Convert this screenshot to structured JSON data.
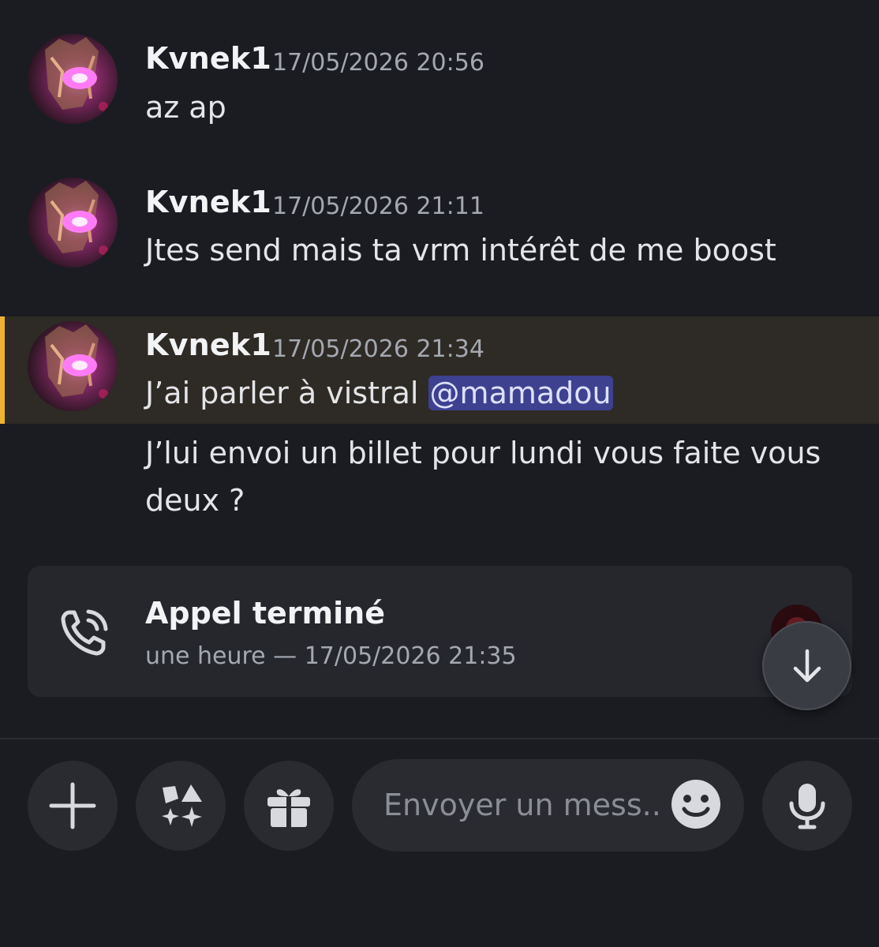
{
  "messages": [
    {
      "author": "Kvnek1",
      "time": "17/05/2026 20:56",
      "lines": [
        "az ap"
      ]
    },
    {
      "author": "Kvnek1",
      "time": "17/05/2026 21:11",
      "lines": [
        "Jtes send mais ta vrm intérêt de me boost"
      ]
    },
    {
      "author": "Kvnek1",
      "time": "17/05/2026 21:34",
      "text_before_mention": "J’ai parler à vistral ",
      "mention": "@mamadou",
      "highlighted": true,
      "accent_color": "#f0b232"
    }
  ],
  "followup_lines": [
    "J’lui envoi un billet pour lundi vous faite vous",
    "deux ?"
  ],
  "call": {
    "title": "Appel terminé",
    "subtitle": "une heure — 17/05/2026 21:35",
    "icon": "phone-call-icon"
  },
  "composer": {
    "placeholder": "Envoyer un mess..",
    "buttons": [
      "plus-icon",
      "apps-icon",
      "gift-icon",
      "microphone-icon"
    ],
    "emoji_icon": "smiley-icon"
  },
  "scroll_icon": "arrow-down-icon",
  "colors": {
    "background": "#1b1c21",
    "highlight": "#2e2a25",
    "mention_bg": "#3d4190",
    "card": "#26272d"
  }
}
